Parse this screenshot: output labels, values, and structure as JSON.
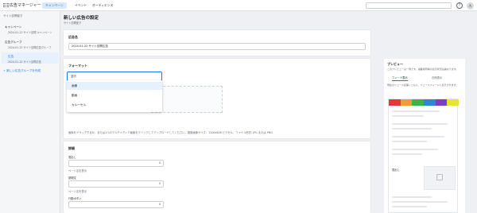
{
  "topbar": {
    "brand": "広告マネージャー",
    "tabs": [
      {
        "label": "キャンペーン",
        "active": true
      },
      {
        "label": "イベント",
        "active": false
      },
      {
        "label": "オーディエンス",
        "active": false
      }
    ],
    "help_glyph": "?",
    "avatar_initial": "A"
  },
  "breadcrumb": "サイト訪問促す",
  "sidebar": {
    "items": [
      {
        "label": "キャンペーン",
        "sub": "2024-01-22 サイト訪問 キャンペーン"
      },
      {
        "label": "広告グループ",
        "sub": "2024-01-22 サイト訪問広告グループ"
      },
      {
        "label": "広告",
        "sub": "2024-01-22 サイト訪問広告"
      }
    ],
    "new_group_link": "+ 新しい広告グループを作成"
  },
  "page": {
    "title": "新しい広告の設定",
    "subtitle": "サイト訪問促す"
  },
  "ad_name": {
    "label": "広告名",
    "value": "2024-01-22 サイト訪問広告"
  },
  "format": {
    "label": "フォーマット",
    "selected_placeholder": "選択",
    "options": [
      "画像",
      "動画",
      "カルーセル"
    ],
    "note": "画像をドラッグするか、または1つのマルチメディア画像をクリックしてアップロードしてください。推奨画像サイズ：1200x628 ピクセル、ファイル形式: JPG または PNG"
  },
  "detail": {
    "label": "詳細",
    "headline_label": "見出し",
    "headline_count": "0",
    "headline_hint": "ページ名を表示",
    "description_label": "説明文",
    "description_count": "0",
    "description_hint": "ページ名を表示",
    "cta_label": "行動ボタン",
    "cta_count": "0"
  },
  "preview": {
    "label": "プレビュー",
    "description": "このプレビューは一例です。掲載場所等の表示状況は異なります。",
    "tabs": [
      "フィード表示",
      "右側表示"
    ],
    "caption": "現在のニュース記事とともに、ニュースフィードに表示されます。",
    "stripe_colors": [
      "#e4393c",
      "#f29d38",
      "#3cb44b",
      "#2d86d9",
      "#7b3fc6",
      "#e3e33a"
    ],
    "mock_text": "見出し"
  }
}
